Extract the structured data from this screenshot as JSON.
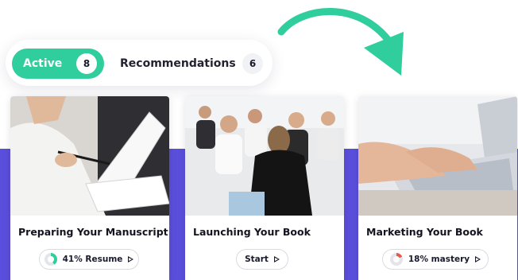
{
  "tabs": {
    "active": {
      "label": "Active",
      "count": "8"
    },
    "recommendations": {
      "label": "Recommendations",
      "count": "6"
    }
  },
  "cards": [
    {
      "title": "Preparing Your Manuscript",
      "action": "41% Resume",
      "progress": 0.41,
      "progress_color": "#2fce9c",
      "image": "person-reading-document"
    },
    {
      "title": "Launching Your Book",
      "action": "Start",
      "image": "audience-presentation"
    },
    {
      "title": "Marketing Your Book",
      "action": "18% mastery",
      "progress": 0.18,
      "progress_color": "#e8594b",
      "image": "hands-typing-laptop"
    }
  ],
  "colors": {
    "accent_green": "#2fce9c",
    "band_purple": "#5a4fdc"
  }
}
